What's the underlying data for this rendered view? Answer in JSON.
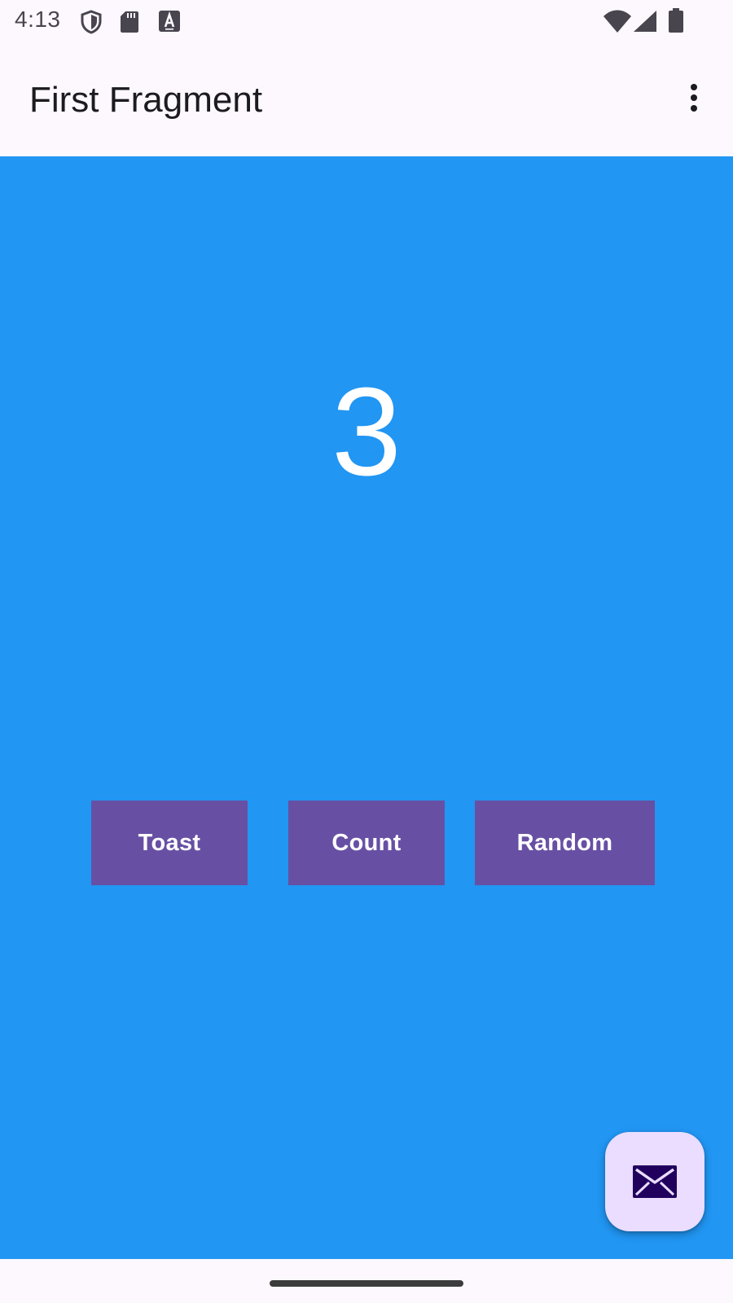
{
  "status_bar": {
    "time": "4:13",
    "left_icons": [
      "shield-icon",
      "sd-card-icon",
      "keyboard-a-icon"
    ],
    "right_icons": [
      "wifi-icon",
      "signal-icon",
      "battery-icon"
    ]
  },
  "app_bar": {
    "title": "First Fragment",
    "overflow_icon": "more-vert-icon"
  },
  "main": {
    "count": "3",
    "buttons": {
      "toast": "Toast",
      "count": "Count",
      "random": "Random"
    }
  },
  "fab": {
    "icon": "email-icon"
  },
  "colors": {
    "content_background": "#2196f3",
    "button_background": "#6750a4",
    "fab_background": "#eaddff",
    "fab_icon": "#21005d"
  }
}
